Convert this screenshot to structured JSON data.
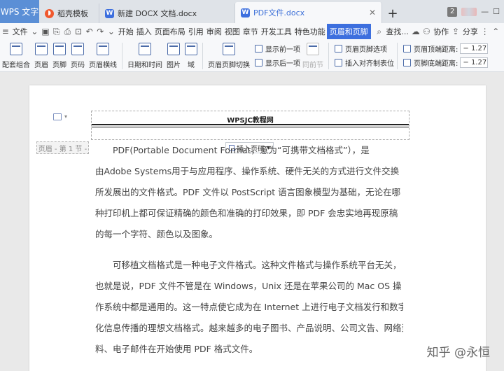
{
  "tabs": {
    "app": "WPS 文字",
    "items": [
      {
        "label": "稻壳模板",
        "icon": "daoke-icon"
      },
      {
        "label": "新建 DOCX 文档.docx",
        "icon": "word-icon"
      },
      {
        "label": "PDF文件.docx",
        "icon": "word-icon",
        "active": true
      }
    ],
    "add": "+",
    "badge": "2"
  },
  "menu": {
    "file": "文件",
    "items": [
      "开始",
      "插入",
      "页面布局",
      "引用",
      "审阅",
      "视图",
      "章节",
      "开发工具",
      "特色功能"
    ],
    "active": "页眉和页脚",
    "search": "查找...",
    "collab": "协作",
    "share": "分享"
  },
  "ribbon": {
    "big": [
      "配套组合",
      "页眉",
      "页脚",
      "页码",
      "页眉横线",
      "日期和时间",
      "图片",
      "域",
      "页眉页脚切换"
    ],
    "col1": [
      "显示前一项",
      "显示后一项"
    ],
    "same_prev": "同前节",
    "col2": [
      "页眉页脚选项",
      "插入对齐制表位"
    ],
    "col3": [
      {
        "label": "页眉顶端距离:",
        "value": "1.27"
      },
      {
        "label": "页脚底端距离:",
        "value": "1.27"
      }
    ]
  },
  "document": {
    "header_text": "WPSJC教程网",
    "header_tag": "页眉 - 第 1 节 -",
    "insert_page": "插入页码",
    "paragraph1": [
      "PDF(Portable Document Format，意为“可携带文档格式”），是",
      "由Adobe Systems用于与应用程序、操作系统、硬件无关的方式进行文件交换",
      "所发展出的文件格式。PDF 文件以 PostScript 语言图象模型为基础，无论在哪",
      "种打印机上都可保证精确的颜色和准确的打印效果，即 PDF 会忠实地再现原稿",
      "的每一个字符、颜色以及图象。"
    ],
    "paragraph2": [
      "可移植文档格式是一种电子文件格式。这种文件格式与操作系统平台无关，",
      "也就是说，PDF 文件不管是在 Windows，Unix 还是在苹果公司的 Mac OS 操",
      "作系统中都是通用的。这一特点使它成为在 Internet 上进行电子文档发行和数字",
      "化信息传播的理想文档格式。越来越多的电子图书、产品说明、公司文告、网络资",
      "料、电子邮件在开始使用 PDF 格式文件。"
    ]
  },
  "watermark": "知乎 @永恒",
  "colors": {
    "accent": "#3d6fde",
    "wps_tab": "#5b8fd6"
  }
}
